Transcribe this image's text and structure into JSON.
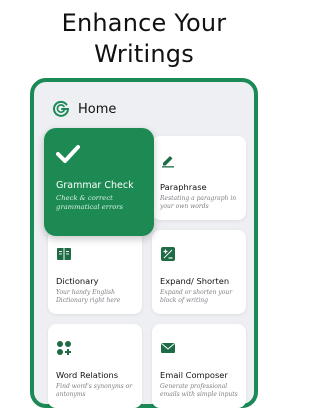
{
  "headline": {
    "line1": "Enhance Your",
    "line2": "Writings"
  },
  "app": {
    "title": "Home",
    "logo_icon": "g-logo-icon"
  },
  "colors": {
    "brand_green": "#1b8a57",
    "card_green": "#1d8a54",
    "icon_green": "#1f6b45",
    "panel_bg": "#eeeff3"
  },
  "cards": [
    {
      "title": "Grammar Check",
      "description": "Check  & correct grammatical errors",
      "icon": "checkmark-icon"
    },
    {
      "title": "Paraphrase",
      "description": "Restating a paragraph in your own words",
      "icon": "pencil-icon"
    },
    {
      "title": "Dictionary",
      "description": "Your handy English Dictionary right here",
      "icon": "book-icon"
    },
    {
      "title": "Expand/ Shorten",
      "description": "Expand or shorten your block of writing",
      "icon": "plus-minus-icon"
    },
    {
      "title": "Word Relations",
      "description": "Find word's synonyms or antonyms",
      "icon": "shapes-icon"
    },
    {
      "title": "Email Composer",
      "description": "Generate professional emails with simple inputs",
      "icon": "envelope-icon"
    }
  ]
}
